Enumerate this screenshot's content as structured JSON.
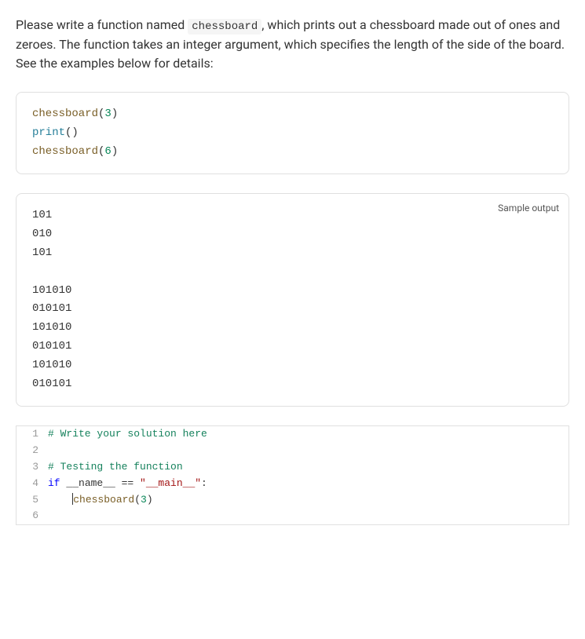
{
  "instructions": {
    "part1": "Please write a function named ",
    "func_name": "chessboard",
    "part2": ", which prints out a chessboard made out of ones and zeroes. The function takes an integer argument, which specifies the length of the side of the board. See the examples below for details:"
  },
  "code_example": {
    "lines": [
      {
        "tokens": [
          {
            "t": "chessboard",
            "c": "c-call"
          },
          {
            "t": "(",
            "c": "c-paren"
          },
          {
            "t": "3",
            "c": "c-num"
          },
          {
            "t": ")",
            "c": "c-paren"
          }
        ]
      },
      {
        "tokens": [
          {
            "t": "print",
            "c": "c-builtin"
          },
          {
            "t": "()",
            "c": "c-paren"
          }
        ]
      },
      {
        "tokens": [
          {
            "t": "chessboard",
            "c": "c-call"
          },
          {
            "t": "(",
            "c": "c-paren"
          },
          {
            "t": "6",
            "c": "c-num"
          },
          {
            "t": ")",
            "c": "c-paren"
          }
        ]
      }
    ]
  },
  "output": {
    "label": "Sample output",
    "text": "101\n010\n101\n\n101010\n010101\n101010\n010101\n101010\n010101\n"
  },
  "editor": {
    "lines": [
      {
        "n": "1",
        "tokens": [
          {
            "t": "# Write your solution here",
            "c": "tok-comment"
          }
        ]
      },
      {
        "n": "2",
        "tokens": []
      },
      {
        "n": "3",
        "tokens": [
          {
            "t": "# Testing the function",
            "c": "tok-comment"
          }
        ]
      },
      {
        "n": "4",
        "tokens": [
          {
            "t": "if",
            "c": "tok-keyword"
          },
          {
            "t": " __name__ == ",
            "c": "tok-func"
          },
          {
            "t": "\"__main__\"",
            "c": "tok-string"
          },
          {
            "t": ":",
            "c": "tok-func"
          }
        ]
      },
      {
        "n": "5",
        "tokens": [
          {
            "t": "    ",
            "c": ""
          },
          {
            "t": "chessboard",
            "c": "tok-call"
          },
          {
            "t": "(",
            "c": "tok-func"
          },
          {
            "t": "3",
            "c": "c-num"
          },
          {
            "t": ")",
            "c": "tok-func"
          }
        ],
        "cursorAfter": 0
      },
      {
        "n": "6",
        "tokens": []
      }
    ]
  }
}
